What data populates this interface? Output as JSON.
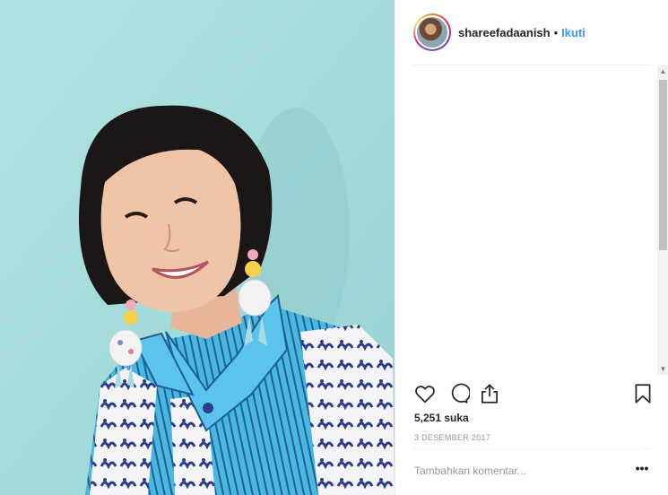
{
  "post": {
    "username": "shareefadaanish",
    "separator": "•",
    "follow_label": "Ikuti",
    "likes_text": "5,251 suka",
    "date_text": "3 DESEMBER 2017",
    "comment_placeholder": "Tambahkan komentar...",
    "more_label": "•••"
  },
  "icons": {
    "like": "heart-icon",
    "comment": "speech-bubble-icon",
    "share": "share-icon",
    "save": "bookmark-icon"
  },
  "colors": {
    "link": "#3897f0",
    "photo_background": "#a8dede",
    "text": "#262626",
    "muted": "#999999"
  }
}
